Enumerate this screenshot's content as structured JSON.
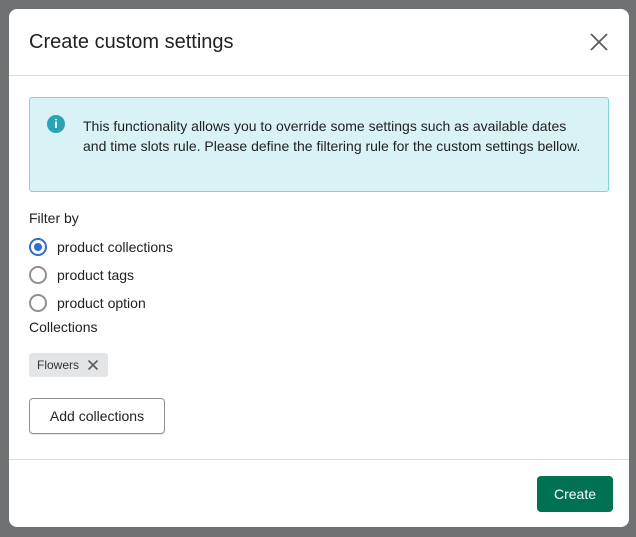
{
  "modal": {
    "title": "Create custom settings"
  },
  "banner": {
    "text": "This functionality allows you to override some settings such as available dates and time slots rule. Please define the filtering rule for the custom settings bellow."
  },
  "filter": {
    "label": "Filter by",
    "options": [
      {
        "label": "product collections",
        "selected": true
      },
      {
        "label": "product tags",
        "selected": false
      },
      {
        "label": "product option",
        "selected": false
      }
    ]
  },
  "collections": {
    "label": "Collections",
    "tags": [
      "Flowers"
    ],
    "add_label": "Add collections"
  },
  "footer": {
    "create_label": "Create"
  },
  "colors": {
    "primary": "#007152",
    "radio": "#2c6ecb",
    "banner": "#d9f2f5"
  }
}
